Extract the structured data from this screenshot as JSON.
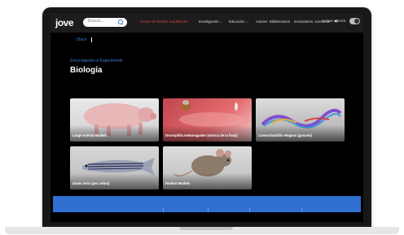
{
  "header": {
    "logo_text": "ve",
    "logo_letter": "jo",
    "search_placeholder": "Buscar...",
    "promo": "Acceso de fuentes académicas",
    "nav": [
      "Investigación",
      "Educación",
      "Autores",
      "Bibliotecarios",
      "Innovadores",
      "Acerca de"
    ],
    "login": "INICIAR SESIÓN"
  },
  "back_label": "Back",
  "encyclopedia_label": "Encyclopedia of Experiments",
  "page_title": "Biología",
  "cards": [
    {
      "label": "Large Animal Models"
    },
    {
      "label": "Drosophila melanogaster (mosca de la fruta)"
    },
    {
      "label": "Caenorhabditis elegans (gusano)"
    },
    {
      "label": "Danio rerio (pez cebra)"
    },
    {
      "label": "Rodent Models"
    }
  ],
  "colors": {
    "accent": "#3b7bd4",
    "promo": "#e24a3b",
    "banner": "#2f6fd0"
  }
}
